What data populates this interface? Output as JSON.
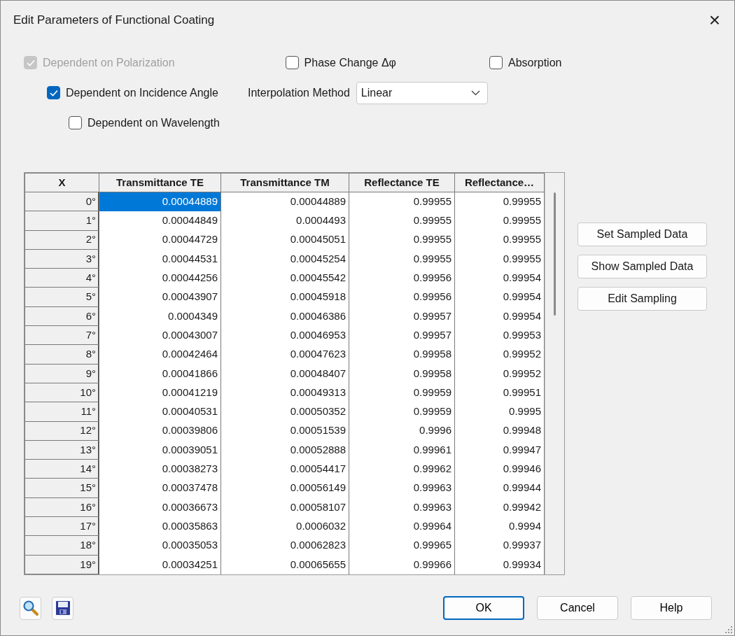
{
  "window": {
    "title": "Edit Parameters of Functional Coating",
    "close": "×"
  },
  "option_rows": [
    [
      {
        "kind": "checkbox",
        "label": "Dependent on Polarization",
        "checked": true,
        "disabled": true
      },
      {
        "kind": "checkbox",
        "label": "Phase Change Δφ",
        "checked": false,
        "disabled": false
      },
      {
        "kind": "checkbox",
        "label": "Absorption",
        "checked": false,
        "disabled": false
      }
    ],
    [
      {
        "kind": "checkbox",
        "label": "Dependent on Incidence Angle",
        "checked": true,
        "disabled": false
      },
      {
        "kind": "dropdown",
        "label": "Interpolation Method",
        "value": "Linear"
      }
    ],
    [
      {
        "kind": "checkbox",
        "label": "Dependent on Wavelength",
        "checked": false,
        "disabled": false
      }
    ]
  ],
  "table": {
    "columns": [
      "X",
      "Transmittance TE",
      "Transmittance TM",
      "Reflectance TE",
      "Reflectance…"
    ],
    "rows": [
      {
        "cells": [
          {
            "text": "0°",
            "selected": false
          },
          {
            "text": "0.00044889",
            "selected": true
          },
          {
            "text": "0.00044889",
            "selected": false
          },
          {
            "text": "0.99955",
            "selected": false
          },
          {
            "text": "0.99955",
            "selected": false
          }
        ]
      },
      {
        "cells": [
          {
            "text": "1°",
            "selected": false
          },
          {
            "text": "0.00044849",
            "selected": false
          },
          {
            "text": "0.0004493",
            "selected": false
          },
          {
            "text": "0.99955",
            "selected": false
          },
          {
            "text": "0.99955",
            "selected": false
          }
        ]
      },
      {
        "cells": [
          {
            "text": "2°",
            "selected": false
          },
          {
            "text": "0.00044729",
            "selected": false
          },
          {
            "text": "0.00045051",
            "selected": false
          },
          {
            "text": "0.99955",
            "selected": false
          },
          {
            "text": "0.99955",
            "selected": false
          }
        ]
      },
      {
        "cells": [
          {
            "text": "3°",
            "selected": false
          },
          {
            "text": "0.00044531",
            "selected": false
          },
          {
            "text": "0.00045254",
            "selected": false
          },
          {
            "text": "0.99955",
            "selected": false
          },
          {
            "text": "0.99955",
            "selected": false
          }
        ]
      },
      {
        "cells": [
          {
            "text": "4°",
            "selected": false
          },
          {
            "text": "0.00044256",
            "selected": false
          },
          {
            "text": "0.00045542",
            "selected": false
          },
          {
            "text": "0.99956",
            "selected": false
          },
          {
            "text": "0.99954",
            "selected": false
          }
        ]
      },
      {
        "cells": [
          {
            "text": "5°",
            "selected": false
          },
          {
            "text": "0.00043907",
            "selected": false
          },
          {
            "text": "0.00045918",
            "selected": false
          },
          {
            "text": "0.99956",
            "selected": false
          },
          {
            "text": "0.99954",
            "selected": false
          }
        ]
      },
      {
        "cells": [
          {
            "text": "6°",
            "selected": false
          },
          {
            "text": "0.0004349",
            "selected": false
          },
          {
            "text": "0.00046386",
            "selected": false
          },
          {
            "text": "0.99957",
            "selected": false
          },
          {
            "text": "0.99954",
            "selected": false
          }
        ]
      },
      {
        "cells": [
          {
            "text": "7°",
            "selected": false
          },
          {
            "text": "0.00043007",
            "selected": false
          },
          {
            "text": "0.00046953",
            "selected": false
          },
          {
            "text": "0.99957",
            "selected": false
          },
          {
            "text": "0.99953",
            "selected": false
          }
        ]
      },
      {
        "cells": [
          {
            "text": "8°",
            "selected": false
          },
          {
            "text": "0.00042464",
            "selected": false
          },
          {
            "text": "0.00047623",
            "selected": false
          },
          {
            "text": "0.99958",
            "selected": false
          },
          {
            "text": "0.99952",
            "selected": false
          }
        ]
      },
      {
        "cells": [
          {
            "text": "9°",
            "selected": false
          },
          {
            "text": "0.00041866",
            "selected": false
          },
          {
            "text": "0.00048407",
            "selected": false
          },
          {
            "text": "0.99958",
            "selected": false
          },
          {
            "text": "0.99952",
            "selected": false
          }
        ]
      },
      {
        "cells": [
          {
            "text": "10°",
            "selected": false
          },
          {
            "text": "0.00041219",
            "selected": false
          },
          {
            "text": "0.00049313",
            "selected": false
          },
          {
            "text": "0.99959",
            "selected": false
          },
          {
            "text": "0.99951",
            "selected": false
          }
        ]
      },
      {
        "cells": [
          {
            "text": "11°",
            "selected": false
          },
          {
            "text": "0.00040531",
            "selected": false
          },
          {
            "text": "0.00050352",
            "selected": false
          },
          {
            "text": "0.99959",
            "selected": false
          },
          {
            "text": "0.9995",
            "selected": false
          }
        ]
      },
      {
        "cells": [
          {
            "text": "12°",
            "selected": false
          },
          {
            "text": "0.00039806",
            "selected": false
          },
          {
            "text": "0.00051539",
            "selected": false
          },
          {
            "text": "0.9996",
            "selected": false
          },
          {
            "text": "0.99948",
            "selected": false
          }
        ]
      },
      {
        "cells": [
          {
            "text": "13°",
            "selected": false
          },
          {
            "text": "0.00039051",
            "selected": false
          },
          {
            "text": "0.00052888",
            "selected": false
          },
          {
            "text": "0.99961",
            "selected": false
          },
          {
            "text": "0.99947",
            "selected": false
          }
        ]
      },
      {
        "cells": [
          {
            "text": "14°",
            "selected": false
          },
          {
            "text": "0.00038273",
            "selected": false
          },
          {
            "text": "0.00054417",
            "selected": false
          },
          {
            "text": "0.99962",
            "selected": false
          },
          {
            "text": "0.99946",
            "selected": false
          }
        ]
      },
      {
        "cells": [
          {
            "text": "15°",
            "selected": false
          },
          {
            "text": "0.00037478",
            "selected": false
          },
          {
            "text": "0.00056149",
            "selected": false
          },
          {
            "text": "0.99963",
            "selected": false
          },
          {
            "text": "0.99944",
            "selected": false
          }
        ]
      },
      {
        "cells": [
          {
            "text": "16°",
            "selected": false
          },
          {
            "text": "0.00036673",
            "selected": false
          },
          {
            "text": "0.00058107",
            "selected": false
          },
          {
            "text": "0.99963",
            "selected": false
          },
          {
            "text": "0.99942",
            "selected": false
          }
        ]
      },
      {
        "cells": [
          {
            "text": "17°",
            "selected": false
          },
          {
            "text": "0.00035863",
            "selected": false
          },
          {
            "text": "0.0006032",
            "selected": false
          },
          {
            "text": "0.99964",
            "selected": false
          },
          {
            "text": "0.9994",
            "selected": false
          }
        ]
      },
      {
        "cells": [
          {
            "text": "18°",
            "selected": false
          },
          {
            "text": "0.00035053",
            "selected": false
          },
          {
            "text": "0.00062823",
            "selected": false
          },
          {
            "text": "0.99965",
            "selected": false
          },
          {
            "text": "0.99937",
            "selected": false
          }
        ]
      },
      {
        "cells": [
          {
            "text": "19°",
            "selected": false
          },
          {
            "text": "0.00034251",
            "selected": false
          },
          {
            "text": "0.00065655",
            "selected": false
          },
          {
            "text": "0.99966",
            "selected": false
          },
          {
            "text": "0.99934",
            "selected": false
          }
        ]
      }
    ]
  },
  "side_buttons": [
    "Set Sampled Data",
    "Show Sampled Data",
    "Edit Sampling"
  ],
  "footer_buttons": [
    {
      "label": "OK",
      "default": true
    },
    {
      "label": "Cancel",
      "default": false
    },
    {
      "label": "Help",
      "default": false
    }
  ]
}
